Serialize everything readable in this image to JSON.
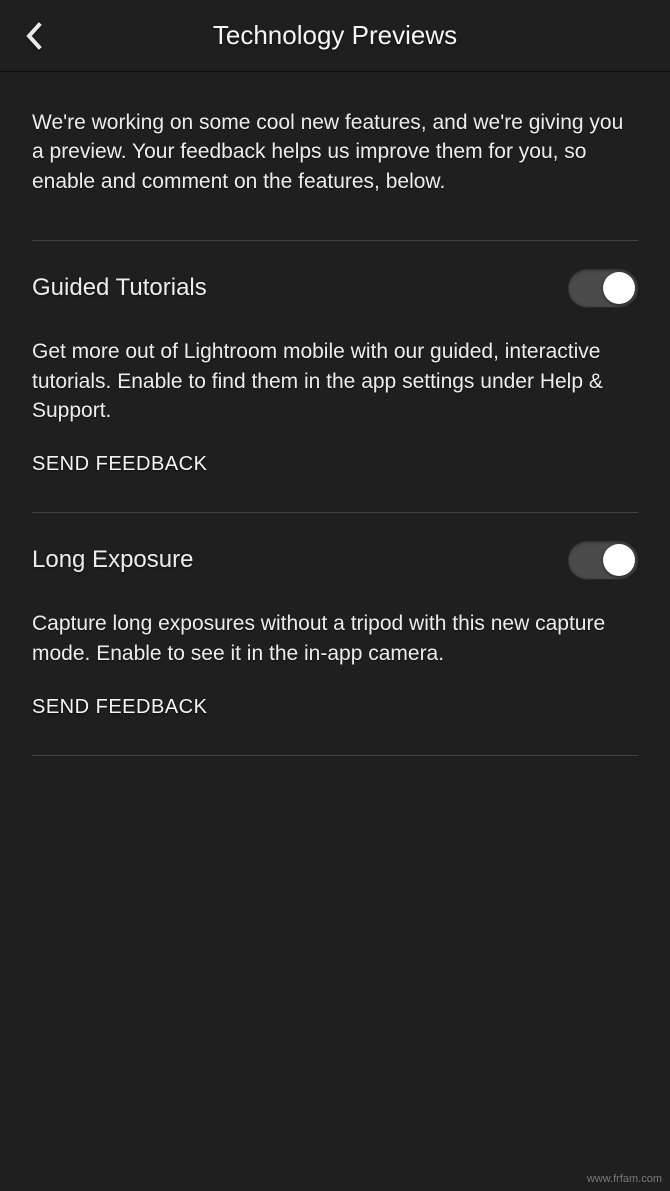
{
  "header": {
    "title": "Technology Previews"
  },
  "intro": "We're working on some cool new features, and we're giving you a preview. Your feedback helps us improve them for you, so enable and comment on the features, below.",
  "features": [
    {
      "title": "Guided Tutorials",
      "enabled": true,
      "description": "Get more out of Lightroom mobile with our guided, interactive tutorials. Enable to find them in the app settings under Help & Support.",
      "feedback_label": "SEND FEEDBACK"
    },
    {
      "title": "Long Exposure",
      "enabled": true,
      "description": "Capture long exposures without a tripod with this new capture mode. Enable to see it in the in-app camera.",
      "feedback_label": "SEND FEEDBACK"
    }
  ],
  "watermark": "www.frfam.com"
}
